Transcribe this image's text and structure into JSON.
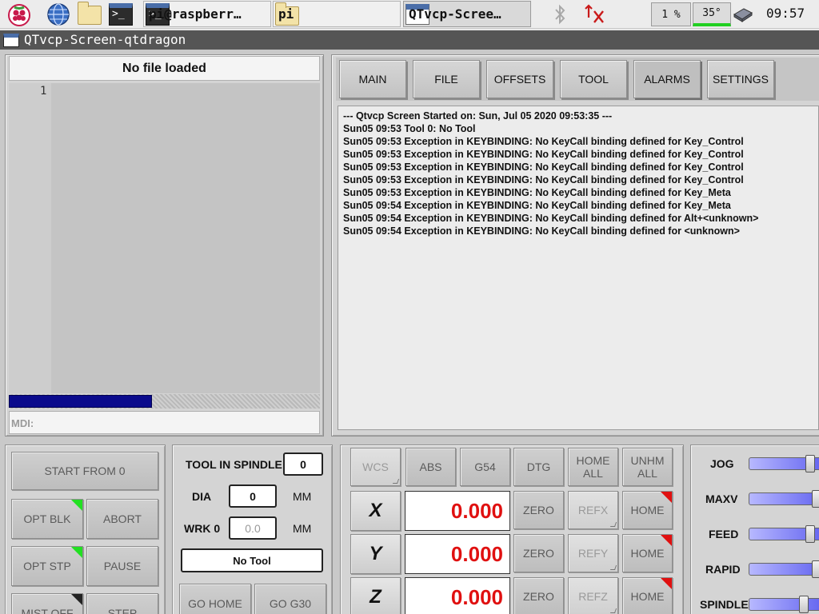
{
  "taskbar": {
    "tasks": [
      {
        "label": "pi@raspberr…"
      },
      {
        "label": "pi"
      },
      {
        "label": "QTvcp-Scree…"
      }
    ],
    "cpu": "1 %",
    "temp": "35°",
    "clock": "09:57"
  },
  "window": {
    "title": "QTvcp-Screen-qtdragon"
  },
  "gcode": {
    "status": "No file loaded",
    "line_number": "1",
    "mdi_label": "MDI:",
    "progress": 0.46
  },
  "tabs": [
    "MAIN",
    "FILE",
    "OFFSETS",
    "TOOL",
    "ALARMS",
    "SETTINGS"
  ],
  "active_tab": "ALARMS",
  "log": [
    "--- Qtvcp Screen Started on: Sun, Jul 05 2020 09:53:35 ---",
    "Sun05 09:53 Tool 0: No Tool",
    "Sun05 09:53 Exception in KEYBINDING: No KeyCall binding defined for Key_Control",
    "Sun05 09:53 Exception in KEYBINDING: No KeyCall binding defined for Key_Control",
    "Sun05 09:53 Exception in KEYBINDING: No KeyCall binding defined for Key_Control",
    "Sun05 09:53 Exception in KEYBINDING: No KeyCall binding defined for Key_Control",
    "Sun05 09:53 Exception in KEYBINDING: No KeyCall binding defined for Key_Meta",
    "Sun05 09:54 Exception in KEYBINDING: No KeyCall binding defined for Key_Meta",
    "Sun05 09:54 Exception in KEYBINDING: No KeyCall binding defined for Alt+<unknown>",
    "Sun05 09:54 Exception in KEYBINDING: No KeyCall binding defined for <unknown>"
  ],
  "run_controls": {
    "start_from": "START FROM 0",
    "opt_blk": "OPT BLK",
    "abort": "ABORT",
    "opt_stp": "OPT STP",
    "pause": "PAUSE",
    "mist": "MIST OFF",
    "step": "STEP"
  },
  "tool": {
    "in_spindle_label": "TOOL IN SPINDLE",
    "in_spindle_value": "0",
    "dia_label": "DIA",
    "dia_value": "0",
    "dia_unit": "MM",
    "wrk_label": "WRK 0",
    "wrk_value": "0.0",
    "wrk_unit": "MM",
    "name": "No Tool",
    "go_home": "GO HOME",
    "go_g30": "GO G30"
  },
  "dro": {
    "wcs": "WCS",
    "abs": "ABS",
    "g54": "G54",
    "dtg": "DTG",
    "home_all": "HOME ALL",
    "unhome_all": "UNHM ALL",
    "zero": "ZERO",
    "home": "HOME",
    "axes": [
      {
        "name": "X",
        "value": "0.000",
        "ref": "REFX"
      },
      {
        "name": "Y",
        "value": "0.000",
        "ref": "REFY"
      },
      {
        "name": "Z",
        "value": "0.000",
        "ref": "REFZ"
      }
    ]
  },
  "sliders": [
    {
      "label": "JOG",
      "level": 0.9
    },
    {
      "label": "MAXV",
      "level": 1.0
    },
    {
      "label": "FEED",
      "level": 0.9
    },
    {
      "label": "RAPID",
      "level": 1.0
    },
    {
      "label": "SPINDLE",
      "level": 0.8
    }
  ]
}
